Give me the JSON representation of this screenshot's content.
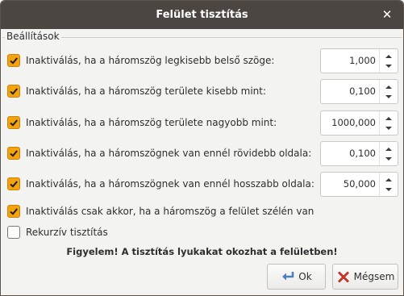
{
  "window": {
    "title": "Felület tisztítás"
  },
  "group": {
    "title": "Beállítások"
  },
  "options": [
    {
      "label": "Inaktiválás, ha a háromszög legkisebb belső szöge:",
      "checked": true,
      "value": "1,000"
    },
    {
      "label": "Inaktiválás, ha a háromszög területe kisebb mint:",
      "checked": true,
      "value": "0,100"
    },
    {
      "label": "Inaktiválás, ha a háromszög területe nagyobb mint:",
      "checked": true,
      "value": "1000,000"
    },
    {
      "label": "Inaktiválás, ha a háromszögnek van ennél rövidebb oldala:",
      "checked": true,
      "value": "0,100"
    },
    {
      "label": "Inaktiválás, ha a háromszögnek van ennél hosszabb oldala:",
      "checked": true,
      "value": "50,000"
    },
    {
      "label": "Inaktiválás csak akkor, ha a háromszög a felület szélén van",
      "checked": true
    },
    {
      "label": "Rekurzív tisztítás",
      "checked": false
    }
  ],
  "warning": "Figyelem! A tisztítás lyukakat okozhat a felületben!",
  "buttons": {
    "ok": "Ok",
    "cancel": "Mégsem"
  },
  "colors": {
    "titlebar": "#4b4641",
    "checkbox_on": "#f4a30e",
    "background": "#f3f3f2"
  }
}
